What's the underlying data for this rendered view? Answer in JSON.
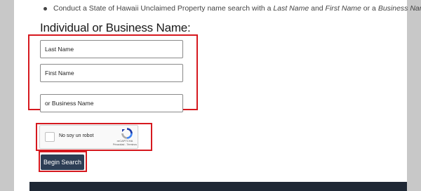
{
  "instructions": {
    "bullet_prefix": "Conduct a State of Hawaii Unclaimed Property name search with a ",
    "last_name": "Last Name",
    "and_text": " and ",
    "first_name": "First Name",
    "or_text": " or a ",
    "business_name": "Business Name",
    "period": "."
  },
  "form": {
    "heading": "Individual or Business Name:",
    "last_name_placeholder": "Last Name",
    "first_name_placeholder": "First Name",
    "business_name_placeholder": "or Business Name",
    "submit_label": "Begin Search"
  },
  "captcha": {
    "label": "No soy un robot",
    "brand": "reCAPTCHA",
    "links": "Privacidad - Términos"
  },
  "colors": {
    "highlight": "#d6191f",
    "button": "#2d3e55",
    "footer": "#1f2835",
    "side_bars": "#c8c8c8"
  }
}
